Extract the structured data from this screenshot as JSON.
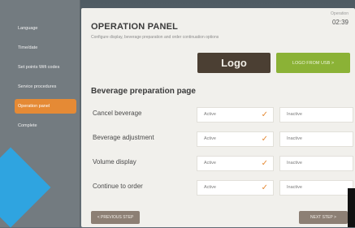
{
  "sidebar": {
    "items": [
      {
        "label": "Language",
        "active": false
      },
      {
        "label": "Time/date",
        "active": false
      },
      {
        "label": "Set points Wifi codes",
        "active": false
      },
      {
        "label": "Service procedures",
        "active": false
      },
      {
        "label": "Operation panel",
        "active": true
      },
      {
        "label": "Complete",
        "active": false
      }
    ]
  },
  "header": {
    "title": "OPERATION PANEL",
    "subtitle": "Configure display, beverage preparation and order continuation options",
    "corner_label": "Operation",
    "corner_time": "02:39"
  },
  "logo": {
    "text": "Logo"
  },
  "upload_button": {
    "label": "LOGO FROM USB >"
  },
  "section": {
    "title": "Beverage preparation page"
  },
  "rows": [
    {
      "label": "Cancel beverage",
      "active_label": "Active",
      "inactive_label": "Inactive",
      "selected": "active"
    },
    {
      "label": "Beverage adjustment",
      "active_label": "Active",
      "inactive_label": "Inactive",
      "selected": "active"
    },
    {
      "label": "Volume display",
      "active_label": "Active",
      "inactive_label": "Inactive",
      "selected": "active"
    },
    {
      "label": "Continue to order",
      "active_label": "Active",
      "inactive_label": "Inactive",
      "selected": "active"
    }
  ],
  "nav": {
    "prev_label": "< PREVIOUS STEP",
    "next_label": "NEXT STEP >"
  },
  "colors": {
    "accent": "#e58a35",
    "green": "#8bb236",
    "logo_bg": "#4b3f33",
    "decor_blue": "#2fa4e0"
  },
  "icons": {
    "check": "check-icon"
  }
}
